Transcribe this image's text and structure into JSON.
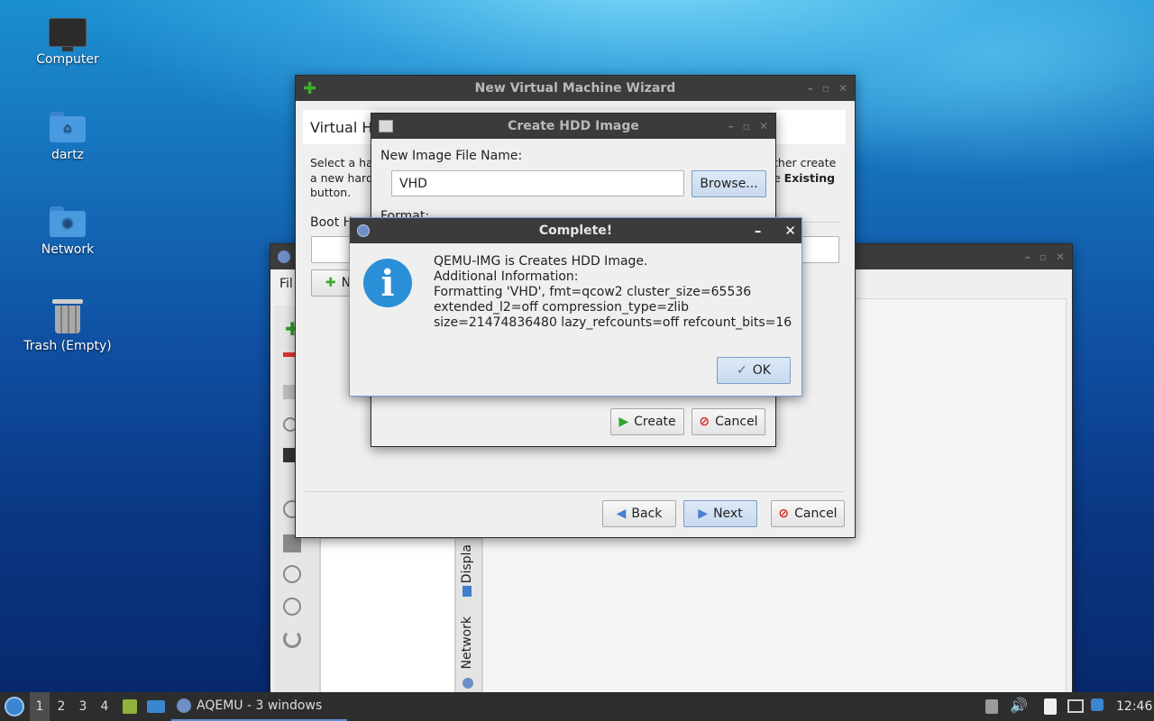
{
  "desktop": {
    "icons": [
      {
        "label": "Computer",
        "icon": "computer-icon"
      },
      {
        "label": "dartz",
        "icon": "home-folder-icon"
      },
      {
        "label": "Network",
        "icon": "network-folder-icon"
      },
      {
        "label": "Trash (Empty)",
        "icon": "trash-icon"
      }
    ]
  },
  "aqemu_window": {
    "menu_file": "Fil",
    "side_tab_display": "Displa",
    "side_tab_network": "Network"
  },
  "wizard": {
    "title": "New Virtual Machine Wizard",
    "heading": "Virtual Ha",
    "desc_line1": "Select a har",
    "desc_line2": "a new hard",
    "desc_line3": "button.",
    "desc_right1": "ther create",
    "desc_right2_pre": "e ",
    "desc_right2_bold": "Existing",
    "boot_label": "Boot H",
    "new_button": "N",
    "back_label": "Back",
    "next_label": "Next",
    "cancel_label": "Cancel"
  },
  "hdd_dialog": {
    "title": "Create HDD Image",
    "file_name_label": "New Image File Name:",
    "file_name_value": "VHD",
    "browse_label": "Browse...",
    "format_label": "Format:",
    "create_label": "Create",
    "cancel_label": "Cancel"
  },
  "complete_dialog": {
    "title": "Complete!",
    "minimize": "–",
    "close": "✕",
    "message_lines": [
      "QEMU-IMG is Creates HDD Image.",
      "Additional Information:",
      "Formatting 'VHD', fmt=qcow2 cluster_size=65536",
      "extended_l2=off compression_type=zlib",
      "size=21474836480 lazy_refcounts=off refcount_bits=16"
    ],
    "ok_label": "OK"
  },
  "taskbar": {
    "workspaces": [
      "1",
      "2",
      "3",
      "4"
    ],
    "active_workspace": "1",
    "task_label": "AQEMU - 3 windows",
    "clock": "12:46"
  },
  "colors": {
    "titlebar": "#3b3b3b",
    "taskbar": "#2d2d2d",
    "info_blue": "#2a8fd6",
    "focus_border": "#7c9cc7"
  }
}
